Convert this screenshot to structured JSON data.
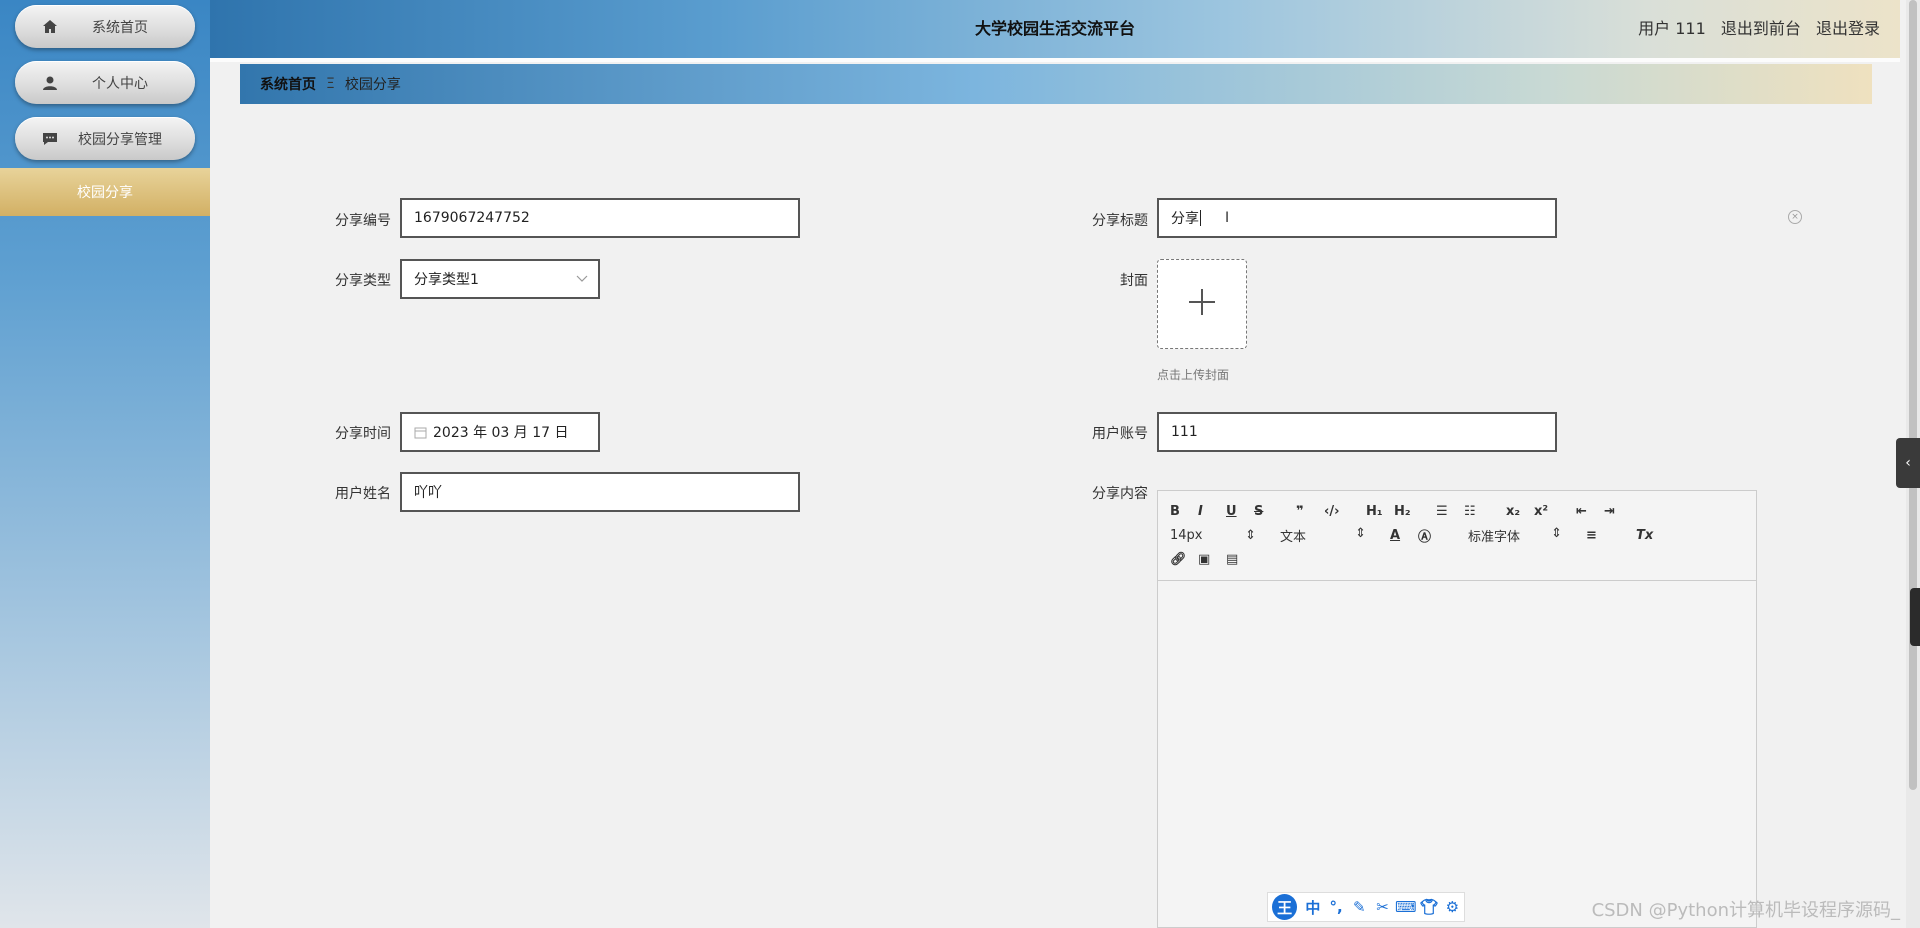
{
  "header": {
    "title": "大学校园生活交流平台",
    "user_label": "用户 111",
    "front_link": "退出到前台",
    "logout_link": "退出登录"
  },
  "sidebar": {
    "items": [
      {
        "label": "系统首页",
        "icon": "home-icon"
      },
      {
        "label": "个人中心",
        "icon": "user-icon"
      },
      {
        "label": "校园分享管理",
        "icon": "chat-icon"
      }
    ],
    "active_sub": "校园分享"
  },
  "breadcrumb": {
    "home": "系统首页",
    "separator": "Ξ",
    "current": "校园分享"
  },
  "form": {
    "share_no": {
      "label": "分享编号",
      "value": "1679067247752"
    },
    "share_title": {
      "label": "分享标题",
      "value": "分享"
    },
    "share_type": {
      "label": "分享类型",
      "value": "分享类型1"
    },
    "cover": {
      "label": "封面",
      "hint": "点击上传封面"
    },
    "share_time": {
      "label": "分享时间",
      "value": "2023 年 03 月 17 日"
    },
    "user_account": {
      "label": "用户账号",
      "value": "111"
    },
    "user_name": {
      "label": "用户姓名",
      "value": "吖吖"
    },
    "share_content": {
      "label": "分享内容"
    }
  },
  "editor": {
    "font_size": "14px",
    "text_type": "文本",
    "font_family": "标准字体"
  },
  "ime": {
    "logo": "王",
    "mode": "中"
  },
  "watermark": "CSDN @Python计算机毕设程序源码_",
  "colors": {
    "accent": "#d2b064",
    "header_start": "#2f74ad"
  }
}
